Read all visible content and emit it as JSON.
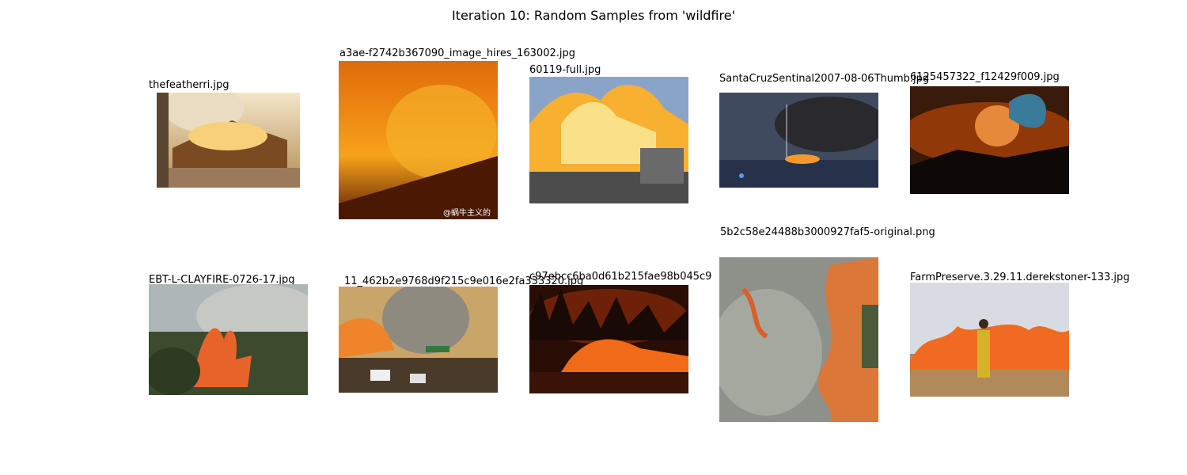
{
  "figure": {
    "title": "Iteration 10: Random Samples from 'wildfire'"
  },
  "samples": [
    {
      "filename": "thefeatherri.jpg",
      "subject": "burning-house"
    },
    {
      "filename": "a3ae-f2742b367090_image_hires_163002.jpg",
      "subject": "orange-glow-hillside-fire",
      "watermark": "@蜗牛主义的"
    },
    {
      "filename": "60119-full.jpg",
      "subject": "flames-over-street"
    },
    {
      "filename": "SantaCruzSentinal2007-08-06Thumb.jpg",
      "subject": "boat-on-fire-at-dusk"
    },
    {
      "filename": "6125457322_f12429f009.jpg",
      "subject": "dragon-over-night-fire"
    },
    {
      "filename": "EBT-L-CLAYFIRE-0726-17.jpg",
      "subject": "forest-fire-with-smoke"
    },
    {
      "filename": "11_462b2e9768d9f215c9e016e2fa333320.jpg",
      "subject": "smoke-plume-over-road"
    },
    {
      "filename": "c97ebcc6ba0d61b215fae98b045c9",
      "subject": "night-hillside-fire-with-firefighters"
    },
    {
      "filename": "5b2c58e24488b3000927faf5-original.png",
      "subject": "aerial-grass-fire"
    },
    {
      "filename": "FarmPreserve.3.29.11.derekstoner-133.jpg",
      "subject": "firefighter-grass-burn"
    }
  ]
}
